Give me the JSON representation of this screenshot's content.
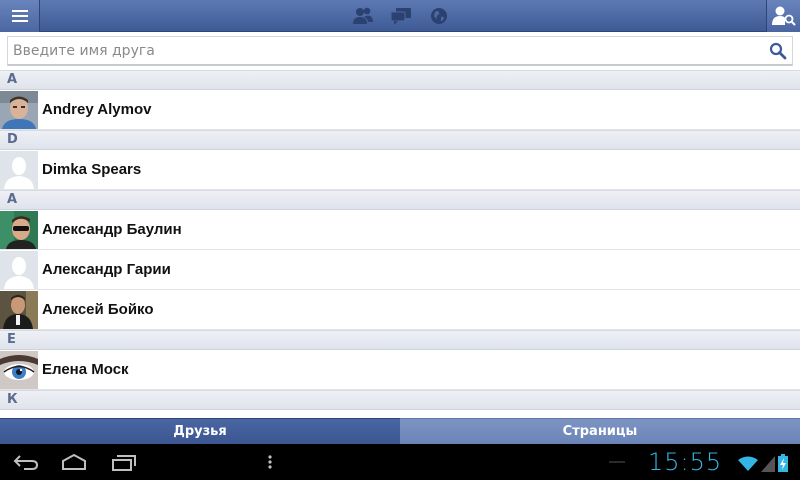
{
  "search": {
    "placeholder": "Введите имя друга"
  },
  "sections": [
    {
      "letter": "A",
      "friends": [
        {
          "name": "Andrey Alymov",
          "avatar": "photo-blue-shirt"
        }
      ]
    },
    {
      "letter": "D",
      "friends": [
        {
          "name": "Dimka Spears",
          "avatar": "default-silhouette"
        }
      ]
    },
    {
      "letter": "А",
      "friends": [
        {
          "name": "Александр Баулин",
          "avatar": "photo-sunglasses"
        },
        {
          "name": "Александр Гарии",
          "avatar": "default-silhouette"
        },
        {
          "name": "Алексей Бойко",
          "avatar": "photo-dark-jacket"
        }
      ]
    },
    {
      "letter": "Е",
      "friends": [
        {
          "name": "Елена Моск",
          "avatar": "photo-blue-eye"
        }
      ]
    },
    {
      "letter": "К",
      "friends": []
    }
  ],
  "tabs": {
    "friends": "Друзья",
    "pages": "Страницы"
  },
  "system": {
    "clock": "15:55"
  },
  "colors": {
    "brand": "#3b5998",
    "accent": "#33b5e5"
  }
}
